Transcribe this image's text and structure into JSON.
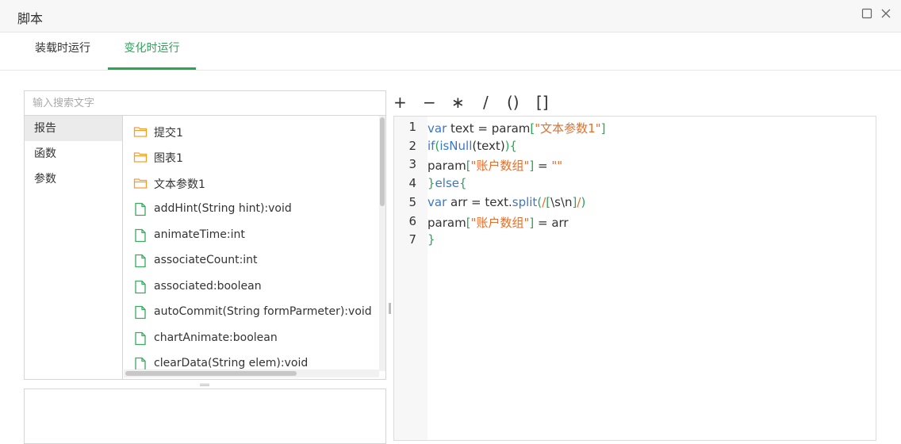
{
  "window": {
    "title": "脚本"
  },
  "tabs": [
    {
      "label": "装载时运行",
      "active": false
    },
    {
      "label": "变化时运行",
      "active": true
    }
  ],
  "search": {
    "placeholder": "输入搜索文字",
    "value": ""
  },
  "categories": [
    {
      "label": "报告",
      "active": true
    },
    {
      "label": "函数",
      "active": false
    },
    {
      "label": "参数",
      "active": false
    }
  ],
  "items": [
    {
      "label": "提交1",
      "icon": "folder-icon"
    },
    {
      "label": "图表1",
      "icon": "folder-icon"
    },
    {
      "label": "文本参数1",
      "icon": "folder-icon"
    },
    {
      "label": "addHint(String hint):void",
      "icon": "file-icon"
    },
    {
      "label": "animateTime:int",
      "icon": "file-icon"
    },
    {
      "label": "associateCount:int",
      "icon": "file-icon"
    },
    {
      "label": "associated:boolean",
      "icon": "file-icon"
    },
    {
      "label": "autoCommit(String formParmeter):void",
      "icon": "file-icon"
    },
    {
      "label": "chartAnimate:boolean",
      "icon": "file-icon"
    },
    {
      "label": "clearData(String elem):void",
      "icon": "file-icon"
    }
  ],
  "operators": [
    "+",
    "−",
    "∗",
    "/",
    "()",
    "[]"
  ],
  "code": {
    "line_numbers": [
      "1",
      "2",
      "3",
      "4",
      "5",
      "6",
      "7"
    ],
    "lines": [
      [
        {
          "t": "var",
          "c": "kw"
        },
        {
          "t": " text = param"
        },
        {
          "t": "[",
          "c": "br"
        },
        {
          "t": "\"文本参数1\"",
          "c": "str"
        },
        {
          "t": "]",
          "c": "br"
        }
      ],
      [
        {
          "t": "if",
          "c": "kw"
        },
        {
          "t": "(",
          "c": "br"
        },
        {
          "t": "isNull",
          "c": "kw"
        },
        {
          "t": "(text)"
        },
        {
          "t": ")",
          "c": "br"
        },
        {
          "t": "{",
          "c": "br"
        }
      ],
      [
        {
          "t": "param"
        },
        {
          "t": "[",
          "c": "br"
        },
        {
          "t": "\"账户数组\"",
          "c": "str"
        },
        {
          "t": "]",
          "c": "br"
        },
        {
          "t": " = "
        },
        {
          "t": "\"\"",
          "c": "str"
        }
      ],
      [
        {
          "t": "}",
          "c": "br"
        },
        {
          "t": "else",
          "c": "kw"
        },
        {
          "t": "{",
          "c": "br"
        }
      ],
      [
        {
          "t": "var",
          "c": "kw"
        },
        {
          "t": " arr = text."
        },
        {
          "t": "split",
          "c": "kw"
        },
        {
          "t": "(",
          "c": "br"
        },
        {
          "t": "/",
          "c": "str"
        },
        {
          "t": "[",
          "c": "br"
        },
        {
          "t": "\\s\\n"
        },
        {
          "t": "]",
          "c": "br"
        },
        {
          "t": "/",
          "c": "str"
        },
        {
          "t": ")",
          "c": "br"
        }
      ],
      [
        {
          "t": "param"
        },
        {
          "t": "[",
          "c": "br"
        },
        {
          "t": "\"账户数组\"",
          "c": "str"
        },
        {
          "t": "]",
          "c": "br"
        },
        {
          "t": " = arr"
        }
      ],
      [
        {
          "t": "}",
          "c": "br"
        }
      ]
    ]
  },
  "colors": {
    "accent": "#2ba458",
    "keyword": "#3a77c5",
    "string": "#e26f2c",
    "folder_icon": "#f0a030",
    "file_icon": "#3aa860"
  }
}
